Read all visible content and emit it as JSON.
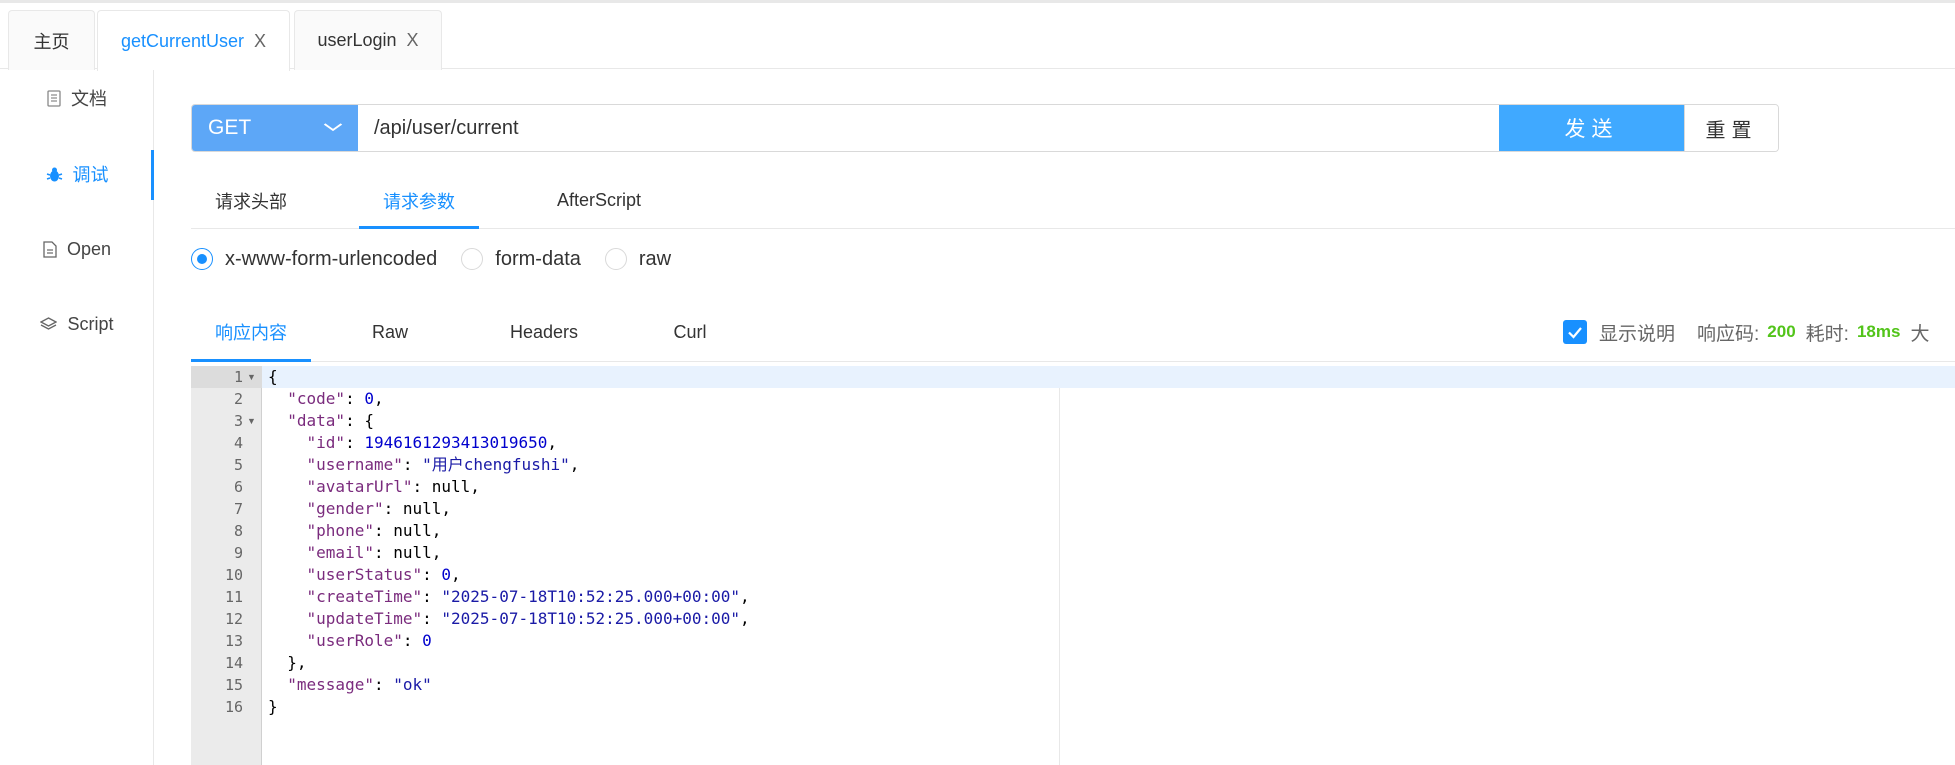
{
  "tabs": [
    {
      "label": "主页",
      "closable": false
    },
    {
      "label": "getCurrentUser",
      "closable": true,
      "active": true
    },
    {
      "label": "userLogin",
      "closable": true
    }
  ],
  "close_glyph": "X",
  "sidebar": {
    "items": [
      {
        "label": "文档",
        "icon": "document-icon"
      },
      {
        "label": "调试",
        "icon": "bug-icon",
        "active": true
      },
      {
        "label": "Open",
        "icon": "file-icon"
      },
      {
        "label": "Script",
        "icon": "code-icon"
      }
    ]
  },
  "request": {
    "method": "GET",
    "url": "/api/user/current",
    "send_label": "发送",
    "reset_label": "重置"
  },
  "request_tabs": [
    {
      "label": "请求头部"
    },
    {
      "label": "请求参数",
      "active": true
    },
    {
      "label": "AfterScript"
    }
  ],
  "body_types": [
    {
      "label": "x-www-form-urlencoded",
      "checked": true
    },
    {
      "label": "form-data"
    },
    {
      "label": "raw"
    }
  ],
  "response_tabs": [
    {
      "label": "响应内容",
      "active": true
    },
    {
      "label": "Raw"
    },
    {
      "label": "Headers"
    },
    {
      "label": "Curl"
    }
  ],
  "response_meta": {
    "show_desc_label": "显示说明",
    "show_desc_checked": true,
    "status_label": "响应码:",
    "status_value": "200",
    "time_label": "耗时:",
    "time_value": "18ms",
    "size_label": "大"
  },
  "colors": {
    "accent": "#1890ff",
    "method_bg": "#5da7f7",
    "send_bg": "#40a9ff",
    "success": "#52c41a"
  },
  "editor": {
    "line_numbers": [
      "1",
      "2",
      "3",
      "4",
      "5",
      "6",
      "7",
      "8",
      "9",
      "10",
      "11",
      "12",
      "13",
      "14",
      "15",
      "16"
    ],
    "lines": [
      "{",
      "  \"code\": 0,",
      "  \"data\": {",
      "    \"id\": 1946161293413019650,",
      "    \"username\": \"用户chengfushi\",",
      "    \"avatarUrl\": null,",
      "    \"gender\": null,",
      "    \"phone\": null,",
      "    \"email\": null,",
      "    \"userStatus\": 0,",
      "    \"createTime\": \"2025-07-18T10:52:25.000+00:00\",",
      "    \"updateTime\": \"2025-07-18T10:52:25.000+00:00\",",
      "    \"userRole\": 0",
      "  },",
      "  \"message\": \"ok\"",
      "}"
    ]
  }
}
